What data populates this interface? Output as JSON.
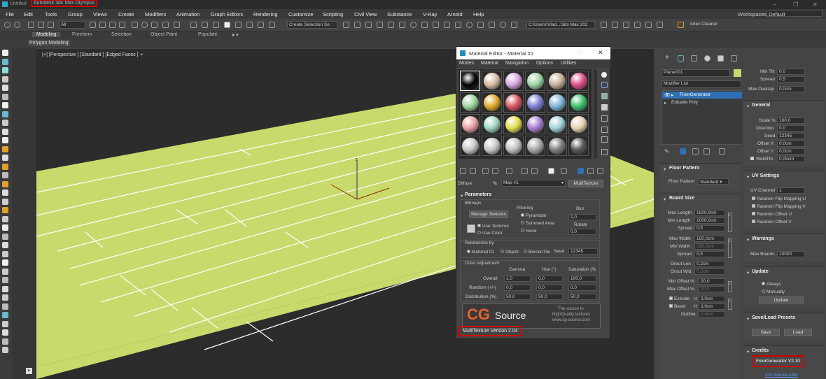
{
  "titlebar": {
    "doc": "Untitled",
    "app": "Autodesk 3ds Max Olympus",
    "workspace_label": "Workspaces:",
    "workspace": "Default"
  },
  "menu": [
    "File",
    "Edit",
    "Tools",
    "Group",
    "Views",
    "Create",
    "Modifiers",
    "Animation",
    "Graph Editors",
    "Rendering",
    "Customize",
    "Scripting",
    "Civil View",
    "Substance",
    "V-Ray",
    "Arnold",
    "Help"
  ],
  "toolbar": {
    "filter": "All",
    "selset": "Create Selection Se",
    "path": "C:\\Users\\Vlad...\\3ds Max 202",
    "plugin": "ertex Cleaner"
  },
  "ribbon": {
    "tabs": [
      "Modeling",
      "Freeform",
      "Selection",
      "Object Paint",
      "Populate"
    ],
    "sub": "Polygon Modeling"
  },
  "viewport": {
    "label": "[+] [Perspective ] [Standard ] [Edged Faces ]",
    "floor_color": "#c9da6c"
  },
  "material_editor": {
    "title": "Material Editor - Material #1",
    "menu": [
      "Modes",
      "Material",
      "Navigation",
      "Options",
      "Utilities"
    ],
    "sphere_colors": [
      "#050505",
      "#d9bca6",
      "#d6a6e0",
      "#9fd6a5",
      "#c7b09a",
      "#e0508a",
      "#9ed6a0",
      "#e5a92b",
      "#d85560",
      "#7f7fd8",
      "#7fb6d8",
      "#3cc26a",
      "#e8a0a6",
      "#9fd6c0",
      "#e2dc50",
      "#a67fd0",
      "#a0d2d8",
      "#e6d2b0",
      "#c8c8c8",
      "#c8c8c8",
      "#c0c0c0",
      "#a8a8a8",
      "#808080",
      "#585858"
    ],
    "diffuse_label": "Diffuse:",
    "map": "Map #1",
    "map_type": "MultiTexture",
    "parameters": "Parameters",
    "bitmaps": "Bitmaps",
    "manage": "Manage Textures",
    "use_textures": "Use Textures",
    "use_color": "Use Color",
    "filtering": "Filtering",
    "f_pyramidal": "Pyramidal",
    "f_summed": "Summed Area",
    "f_none": "None",
    "blur": "Blur",
    "blur_val": "1,0",
    "rotate": "Rotate",
    "rotate_val": "0,0",
    "randomize": "Randomize by",
    "r_material": "Material ID",
    "r_object": "Object",
    "r_bercon": "BerconTile",
    "seed_label": "Seed",
    "seed": "12345",
    "coloradj": "Color Adjustment",
    "gamma": "Gamma",
    "hue": "Hue (°)",
    "sat": "Saturation (%",
    "rows": [
      {
        "label": "Overall",
        "v": [
          "1,0",
          "0,0",
          "100,0"
        ]
      },
      {
        "label": "Random (+/-)",
        "v": [
          "0,0",
          "0,0",
          "0,0"
        ]
      },
      {
        "label": "Distribution (%)",
        "v": [
          "50,0",
          "50,0",
          "50,0"
        ]
      }
    ],
    "banner_cg": "CG",
    "banner_source": "Source",
    "banner_tag1": "The source to",
    "banner_tag2": "HighQuality textures",
    "banner_url": "www.cg-source.com",
    "version": "MultiTexture Version 2.04"
  },
  "command": {
    "object": "Plane001",
    "object_color": "#c9da6c",
    "modlist": "Modifier List",
    "mods": [
      "FloorGenerator",
      "Editable Poly"
    ],
    "floor_pattern": "Floor Pattern",
    "fp_label": "Floor Pattern",
    "fp_value": "Standard",
    "board_size": "Board Size",
    "bs": [
      {
        "l": "Max Length",
        "v": "1500,0cm"
      },
      {
        "l": "Min Length",
        "v": "1000,0cm"
      },
      {
        "l": "Spread",
        "v": "0,5"
      },
      {
        "l": "Max Width",
        "v": "150,0cm"
      },
      {
        "l": "Min Width",
        "v": "150,0cm"
      },
      {
        "l": "Spread",
        "v": "0,5"
      },
      {
        "l": "Grout Len",
        "v": "0,2cm"
      },
      {
        "l": "Grout Wid",
        "v": "0,2cm"
      },
      {
        "l": "Min Offset %",
        "v": "20,0"
      },
      {
        "l": "Max Offset %",
        "v": "20,0"
      }
    ],
    "extrude": "Extrude",
    "extrude_h": "H",
    "extrude_v": "3,0cm",
    "bevel": "Bevel",
    "bevel_h": "H",
    "bevel_v": "3,0cm",
    "outline": "Outline",
    "outline_v": "0,0cm"
  },
  "right": {
    "top": [
      {
        "l": "Min Tilt",
        "v": "0,0"
      },
      {
        "l": "Spread",
        "v": "0,5"
      },
      {
        "l": "Max Overlap",
        "v": "0,0cm"
      }
    ],
    "general": "General",
    "gen": [
      {
        "l": "Scale %",
        "v": "100,0"
      },
      {
        "l": "Direction",
        "v": "0,0"
      },
      {
        "l": "Seed",
        "v": "12345"
      },
      {
        "l": "Offset X",
        "v": "0,0cm"
      },
      {
        "l": "Offset Y",
        "v": "0,0cm"
      },
      {
        "l": "WeldThr.",
        "v": "0,05cm"
      }
    ],
    "uv": "UV Settings",
    "uvchan_l": "UV Channel",
    "uvchan_v": "1",
    "uvchk": [
      "Random Flip Mapping U",
      "Random Flip Mapping V",
      "Random Offset U",
      "Random Offset V"
    ],
    "warnings": "Warnings",
    "maxboards_l": "Max Boards",
    "maxboards_v": "10000",
    "update": "Update",
    "always": "Always",
    "manually": "Manually",
    "update_btn": "Update",
    "presets": "Save/Load Presets",
    "save": "Save",
    "load": "Load",
    "credits": "Credits",
    "version": "FloorGenerator V2.10",
    "url": "CG-Source.com"
  }
}
